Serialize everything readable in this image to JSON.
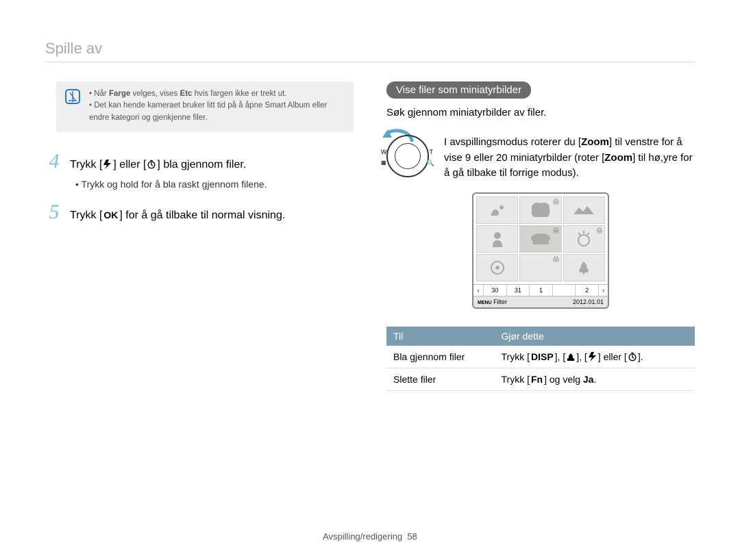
{
  "page": {
    "title": "Spille av",
    "footer_section": "Avspilling/redigering",
    "footer_page": "58"
  },
  "note": {
    "line1_pre": "Når ",
    "line1_b1": "Farge",
    "line1_mid": " velges, vises ",
    "line1_b2": "Etc",
    "line1_post": " hvis fargen ikke er trekt ut.",
    "line2": "Det kan hende kameraet bruker litt tid på å åpne Smart Album eller endre kategori og gjenkjenne filer."
  },
  "steps": {
    "s4_pre": "Trykk [",
    "s4_mid": "] eller [",
    "s4_post": "] bla gjennom filer.",
    "s4_sub": "Trykk og hold for å bla raskt gjennom filene.",
    "s5_pre": "Trykk [",
    "s5_key": "OK",
    "s5_post": "] for å gå tilbake til normal visning."
  },
  "right": {
    "pill": "Vise filer som miniatyrbilder",
    "lead": "Søk gjennom miniatyrbilder av filer.",
    "zoom_pre": "I avspillingsmodus roterer du [",
    "zoom_b1": "Zoom",
    "zoom_mid1": "] til venstre for å vise 9 eller 20 miniatyrbilder (roter [",
    "zoom_b2": "Zoom",
    "zoom_mid2": "] til hø,yre for å gå tilbake til forrige modus)."
  },
  "thumbframe": {
    "dates": [
      "30",
      "31",
      "1",
      "2"
    ],
    "filter_label": "Filter",
    "date": "2012.01.01",
    "menu": "MENU"
  },
  "table": {
    "h1": "Til",
    "h2": "Gjør dette",
    "r1c1": "Bla gjennom filer",
    "r1c2_pre": "Trykk [",
    "r1c2_k1": "DISP",
    "r1c2_mid": "], [",
    "r1c2_sep": "], [",
    "r1c2_or": "] eller [",
    "r1c2_post": "].",
    "r2c1": "Slette filer",
    "r2c2_pre": "Trykk [",
    "r2c2_k": "Fn",
    "r2c2_mid": "] og velg ",
    "r2c2_b": "Ja",
    "r2c2_post": "."
  }
}
